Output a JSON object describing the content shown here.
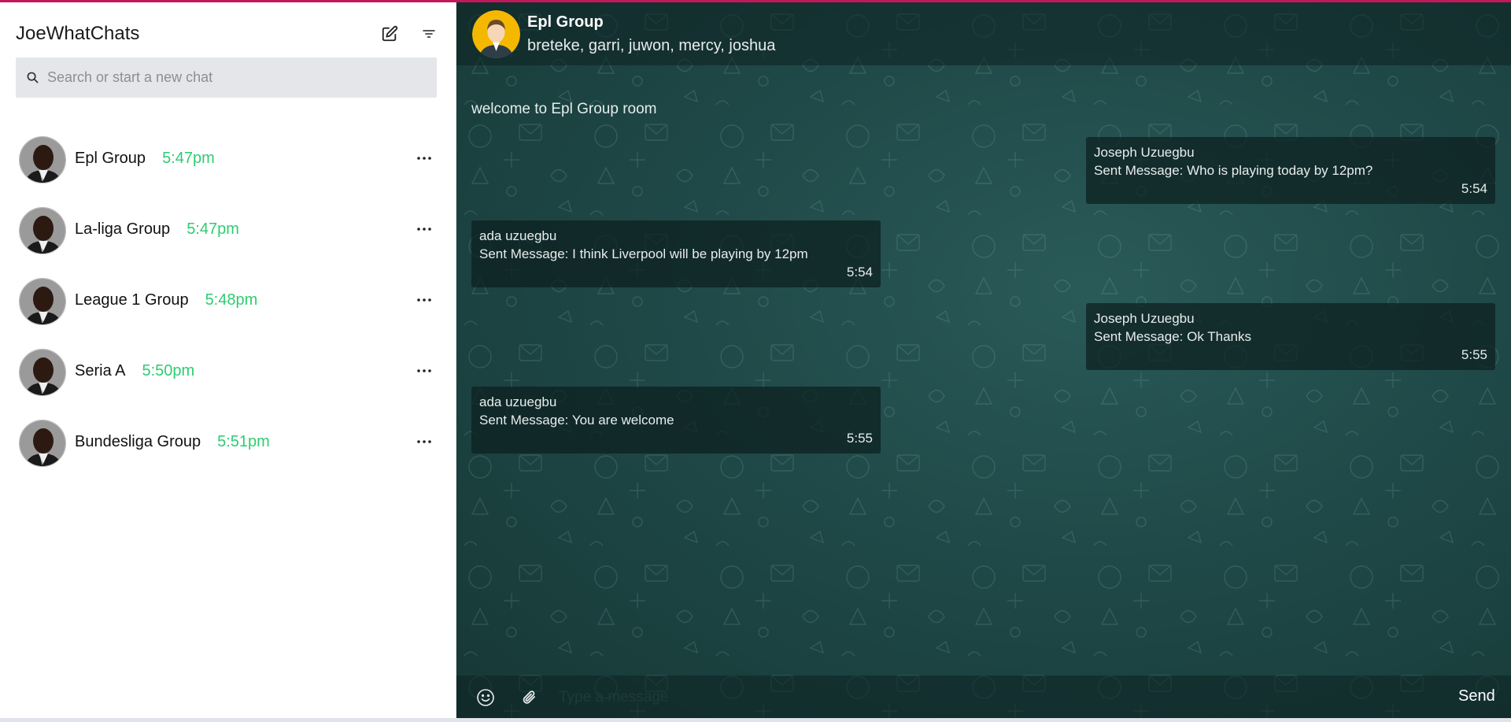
{
  "colors": {
    "accent_top": "#c2185b",
    "time_green": "#2ecc71",
    "chat_bg": "#1f4948"
  },
  "sidebar": {
    "title": "JoeWhatChats",
    "compose_icon": "edit-icon",
    "filter_icon": "filter-icon",
    "search": {
      "placeholder": "Search or start a new chat",
      "icon": "search-icon"
    },
    "chats": [
      {
        "name": "Epl Group",
        "time": "5:47pm"
      },
      {
        "name": "La-liga Group",
        "time": "5:47pm"
      },
      {
        "name": "League 1 Group",
        "time": "5:48pm"
      },
      {
        "name": "Seria A",
        "time": "5:50pm"
      },
      {
        "name": "Bundesliga Group",
        "time": "5:51pm"
      }
    ]
  },
  "chat": {
    "name": "Epl Group",
    "members": "breteke, garri, juwon, mercy, joshua",
    "welcome": "welcome to Epl Group room",
    "messages": [
      {
        "side": "right",
        "sender": "Joseph Uzuegbu",
        "text": "Sent Message: Who is playing today by 12pm?",
        "time": "5:54"
      },
      {
        "side": "left",
        "sender": "ada uzuegbu",
        "text": "Sent Message: I think Liverpool will be playing by 12pm",
        "time": "5:54"
      },
      {
        "side": "right",
        "sender": "Joseph Uzuegbu",
        "text": "Sent Message: Ok Thanks",
        "time": "5:55"
      },
      {
        "side": "left",
        "sender": "ada uzuegbu",
        "text": "Sent Message: You are welcome",
        "time": "5:55"
      }
    ]
  },
  "composer": {
    "placeholder": "Type a message",
    "send_label": "Send"
  }
}
